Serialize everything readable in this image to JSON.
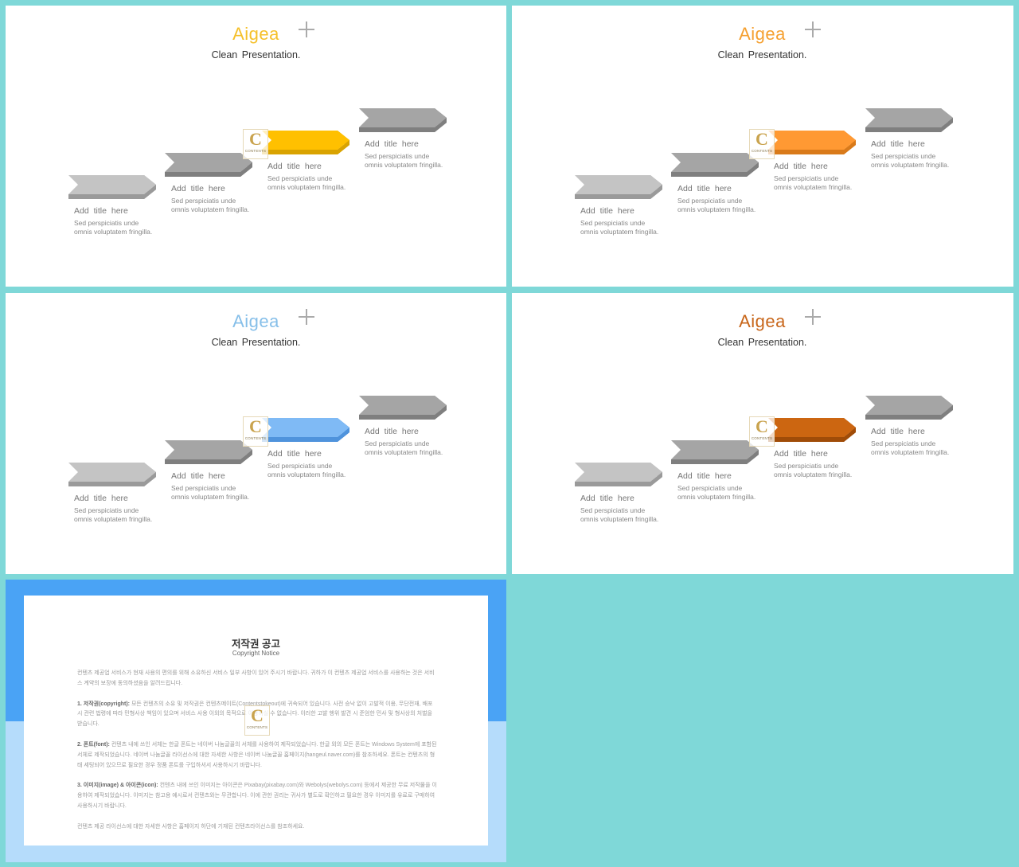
{
  "slides": [
    {
      "brand": "Aigea",
      "brand_color": "#f5c02a",
      "subtitle": "Clean Presentation.",
      "accent_color": "#ffc000",
      "accent_dark": "#d9a300",
      "steps": [
        {
          "title": "Add  title  here",
          "desc_line1": "Sed perspiciatis unde",
          "desc_line2": "omnis voluptatem fringilla."
        },
        {
          "title": "Add  title  here",
          "desc_line1": "Sed perspiciatis unde",
          "desc_line2": "omnis voluptatem fringilla."
        },
        {
          "title": "Add  title  here",
          "desc_line1": "Sed perspiciatis unde",
          "desc_line2": "omnis voluptatem fringilla."
        },
        {
          "title": "Add  title  here",
          "desc_line1": "Sed perspiciatis unde",
          "desc_line2": "omnis voluptatem fringilla."
        }
      ]
    },
    {
      "brand": "Aigea",
      "brand_color": "#f5a030",
      "subtitle": "Clean Presentation.",
      "accent_color": "#ff9933",
      "accent_dark": "#d97a1a",
      "steps": [
        {
          "title": "Add  title  here",
          "desc_line1": "Sed perspiciatis unde",
          "desc_line2": "omnis voluptatem fringilla."
        },
        {
          "title": "Add  title  here",
          "desc_line1": "Sed perspiciatis unde",
          "desc_line2": "omnis voluptatem fringilla."
        },
        {
          "title": "Add  title  here",
          "desc_line1": "Sed perspiciatis unde",
          "desc_line2": "omnis voluptatem fringilla."
        },
        {
          "title": "Add  title  here",
          "desc_line1": "Sed perspiciatis unde",
          "desc_line2": "omnis voluptatem fringilla."
        }
      ]
    },
    {
      "brand": "Aigea",
      "brand_color": "#86bfe9",
      "subtitle": "Clean Presentation.",
      "accent_color": "#7fbaf5",
      "accent_dark": "#4f93dc",
      "steps": [
        {
          "title": "Add  title  here",
          "desc_line1": "Sed perspiciatis unde",
          "desc_line2": "omnis voluptatem fringilla."
        },
        {
          "title": "Add  title  here",
          "desc_line1": "Sed perspiciatis unde",
          "desc_line2": "omnis voluptatem fringilla."
        },
        {
          "title": "Add  title  here",
          "desc_line1": "Sed perspiciatis unde",
          "desc_line2": "omnis voluptatem fringilla."
        },
        {
          "title": "Add  title  here",
          "desc_line1": "Sed perspiciatis unde",
          "desc_line2": "omnis voluptatem fringilla."
        }
      ]
    },
    {
      "brand": "Aigea",
      "brand_color": "#c8661a",
      "subtitle": "Clean Presentation.",
      "accent_color": "#cc6611",
      "accent_dark": "#a04c08",
      "steps": [
        {
          "title": "Add  title  here",
          "desc_line1": "Sed perspiciatis unde",
          "desc_line2": "omnis voluptatem fringilla."
        },
        {
          "title": "Add  title  here",
          "desc_line1": "Sed perspiciatis unde",
          "desc_line2": "omnis voluptatem fringilla."
        },
        {
          "title": "Add  title  here",
          "desc_line1": "Sed perspiciatis unde",
          "desc_line2": "omnis voluptatem fringilla."
        },
        {
          "title": "Add  title  here",
          "desc_line1": "Sed perspiciatis unde",
          "desc_line2": "omnis voluptatem fringilla."
        }
      ]
    }
  ],
  "watermark": {
    "letter": "C",
    "text": "CONTENTS"
  },
  "copyright": {
    "title": "저작권 공고",
    "subtitle": "Copyright Notice",
    "intro": "컨텐츠 제공업 서비스가 현재 사용의 편의를 위해 소유하신 서비스 일부 사항이 있어 주시기 바랍니다. 귀하가 이 컨텐츠 제공업 서비스를 사용하는 것은 서비스 계약의 보장에 동의하셨음을 알려드립니다.",
    "items": [
      {
        "label": "1. 저작권(copyright):",
        "text": " 모든 컨텐츠의 소유 및 저작권은 컨텐츠메이트(Contentstokeout)에 귀속되어 있습니다. 사전 승낙 없이 고발적 이용, 무단전재, 배포 시 관련 법령에 따라 민형사상 책임이 있으며 서비스 사용 이외의 목적으로 이용하실 수 없습니다. 이러한 고발 행위 발견 시 준엄한 민사 및 형사상의 처벌을 받습니다."
      },
      {
        "label": "2. 폰트(font):",
        "text": " 컨텐츠 내에 쓰인 서체는 한글 폰트는 네이버 나눔글꼴의 서체를 사용하여 제작되었습니다. 한글 외의 모든 폰트는 Windows System에 포함된 서체로 제작되었습니다. 네이버 나눔글꼴 라이선스에 대한 자세한 사항은 네이버 나눔글꼴 홈페이지(hangeul.naver.com)를 참조하세요. 폰트는 컨텐츠의 형태 세팅되어 있으므로 필요한 경우 정품 폰트를 구입하셔서 사용하시기 바랍니다."
      },
      {
        "label": "3. 이미지(image) & 아이콘(icon):",
        "text": " 컨텐츠 내에 쓰인 이미지는 아이콘은 Pixabay(pixabay.com)와 Webolys(webolys.com) 등에서 제공한 무료 저작물을 이용하여 제작되었습니다. 이미지는 참고용 예시로서 컨텐츠와는 무관합니다. 이에 관한 권리는 귀사가 별도로 확인하고 필요한 경우 이미지를 유료로 구매하여 사용하시기 바랍니다."
      }
    ],
    "outro": "컨텐츠 제공 라이선스에 대한 자세한 사항은 홈페이지 하단에 기재된 컨텐츠라이선스를 참조하세요."
  }
}
